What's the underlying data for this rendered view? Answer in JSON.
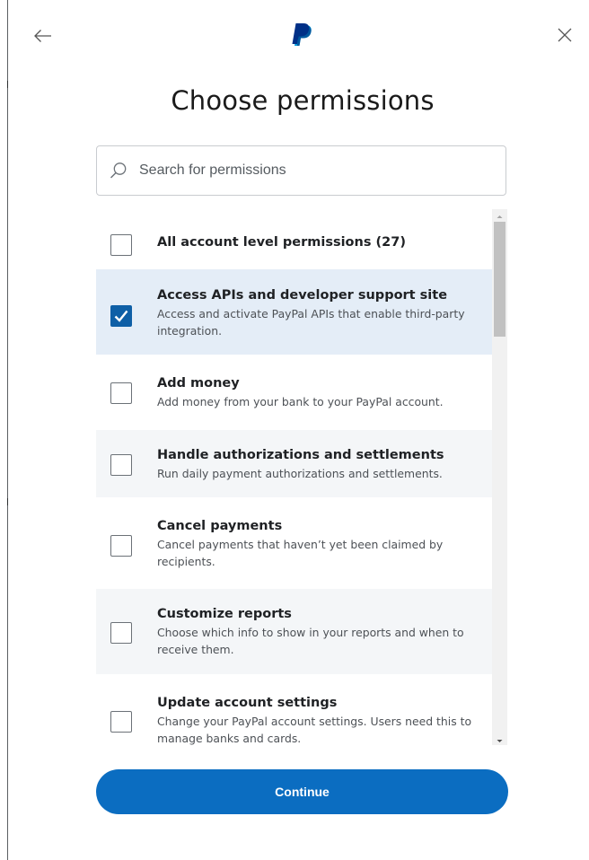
{
  "header": {
    "back_icon": "arrow-left-icon",
    "logo": "paypal-logo",
    "close_icon": "close-icon",
    "title": "Choose permissions"
  },
  "search": {
    "placeholder": "Search for permissions",
    "value": "",
    "icon": "search-icon"
  },
  "permissions": [
    {
      "title": "All account level permissions (27)",
      "description": "",
      "checked": false
    },
    {
      "title": "Access APIs and developer support site",
      "description": "Access and activate PayPal APIs that enable third-party integration.",
      "checked": true
    },
    {
      "title": "Add money",
      "description": "Add money from your bank to your PayPal account.",
      "checked": false
    },
    {
      "title": "Handle authorizations and settlements",
      "description": "Run daily payment authorizations and settlements.",
      "checked": false
    },
    {
      "title": "Cancel payments",
      "description": "Cancel payments that haven’t yet been claimed by recipients.",
      "checked": false
    },
    {
      "title": "Customize reports",
      "description": "Choose which info to show in your reports and when to receive them.",
      "checked": false
    },
    {
      "title": "Update account settings",
      "description": "Change your PayPal account settings. Users need this to manage banks and cards.",
      "checked": false
    }
  ],
  "footer": {
    "continue_label": "Continue"
  },
  "colors": {
    "primary": "#0b6dc1",
    "checkbox_checked": "#0e5fa6",
    "selected_row": "#e4edf7",
    "shaded_row": "#f4f6f8",
    "logo_dark": "#003087",
    "logo_light": "#009cde"
  }
}
